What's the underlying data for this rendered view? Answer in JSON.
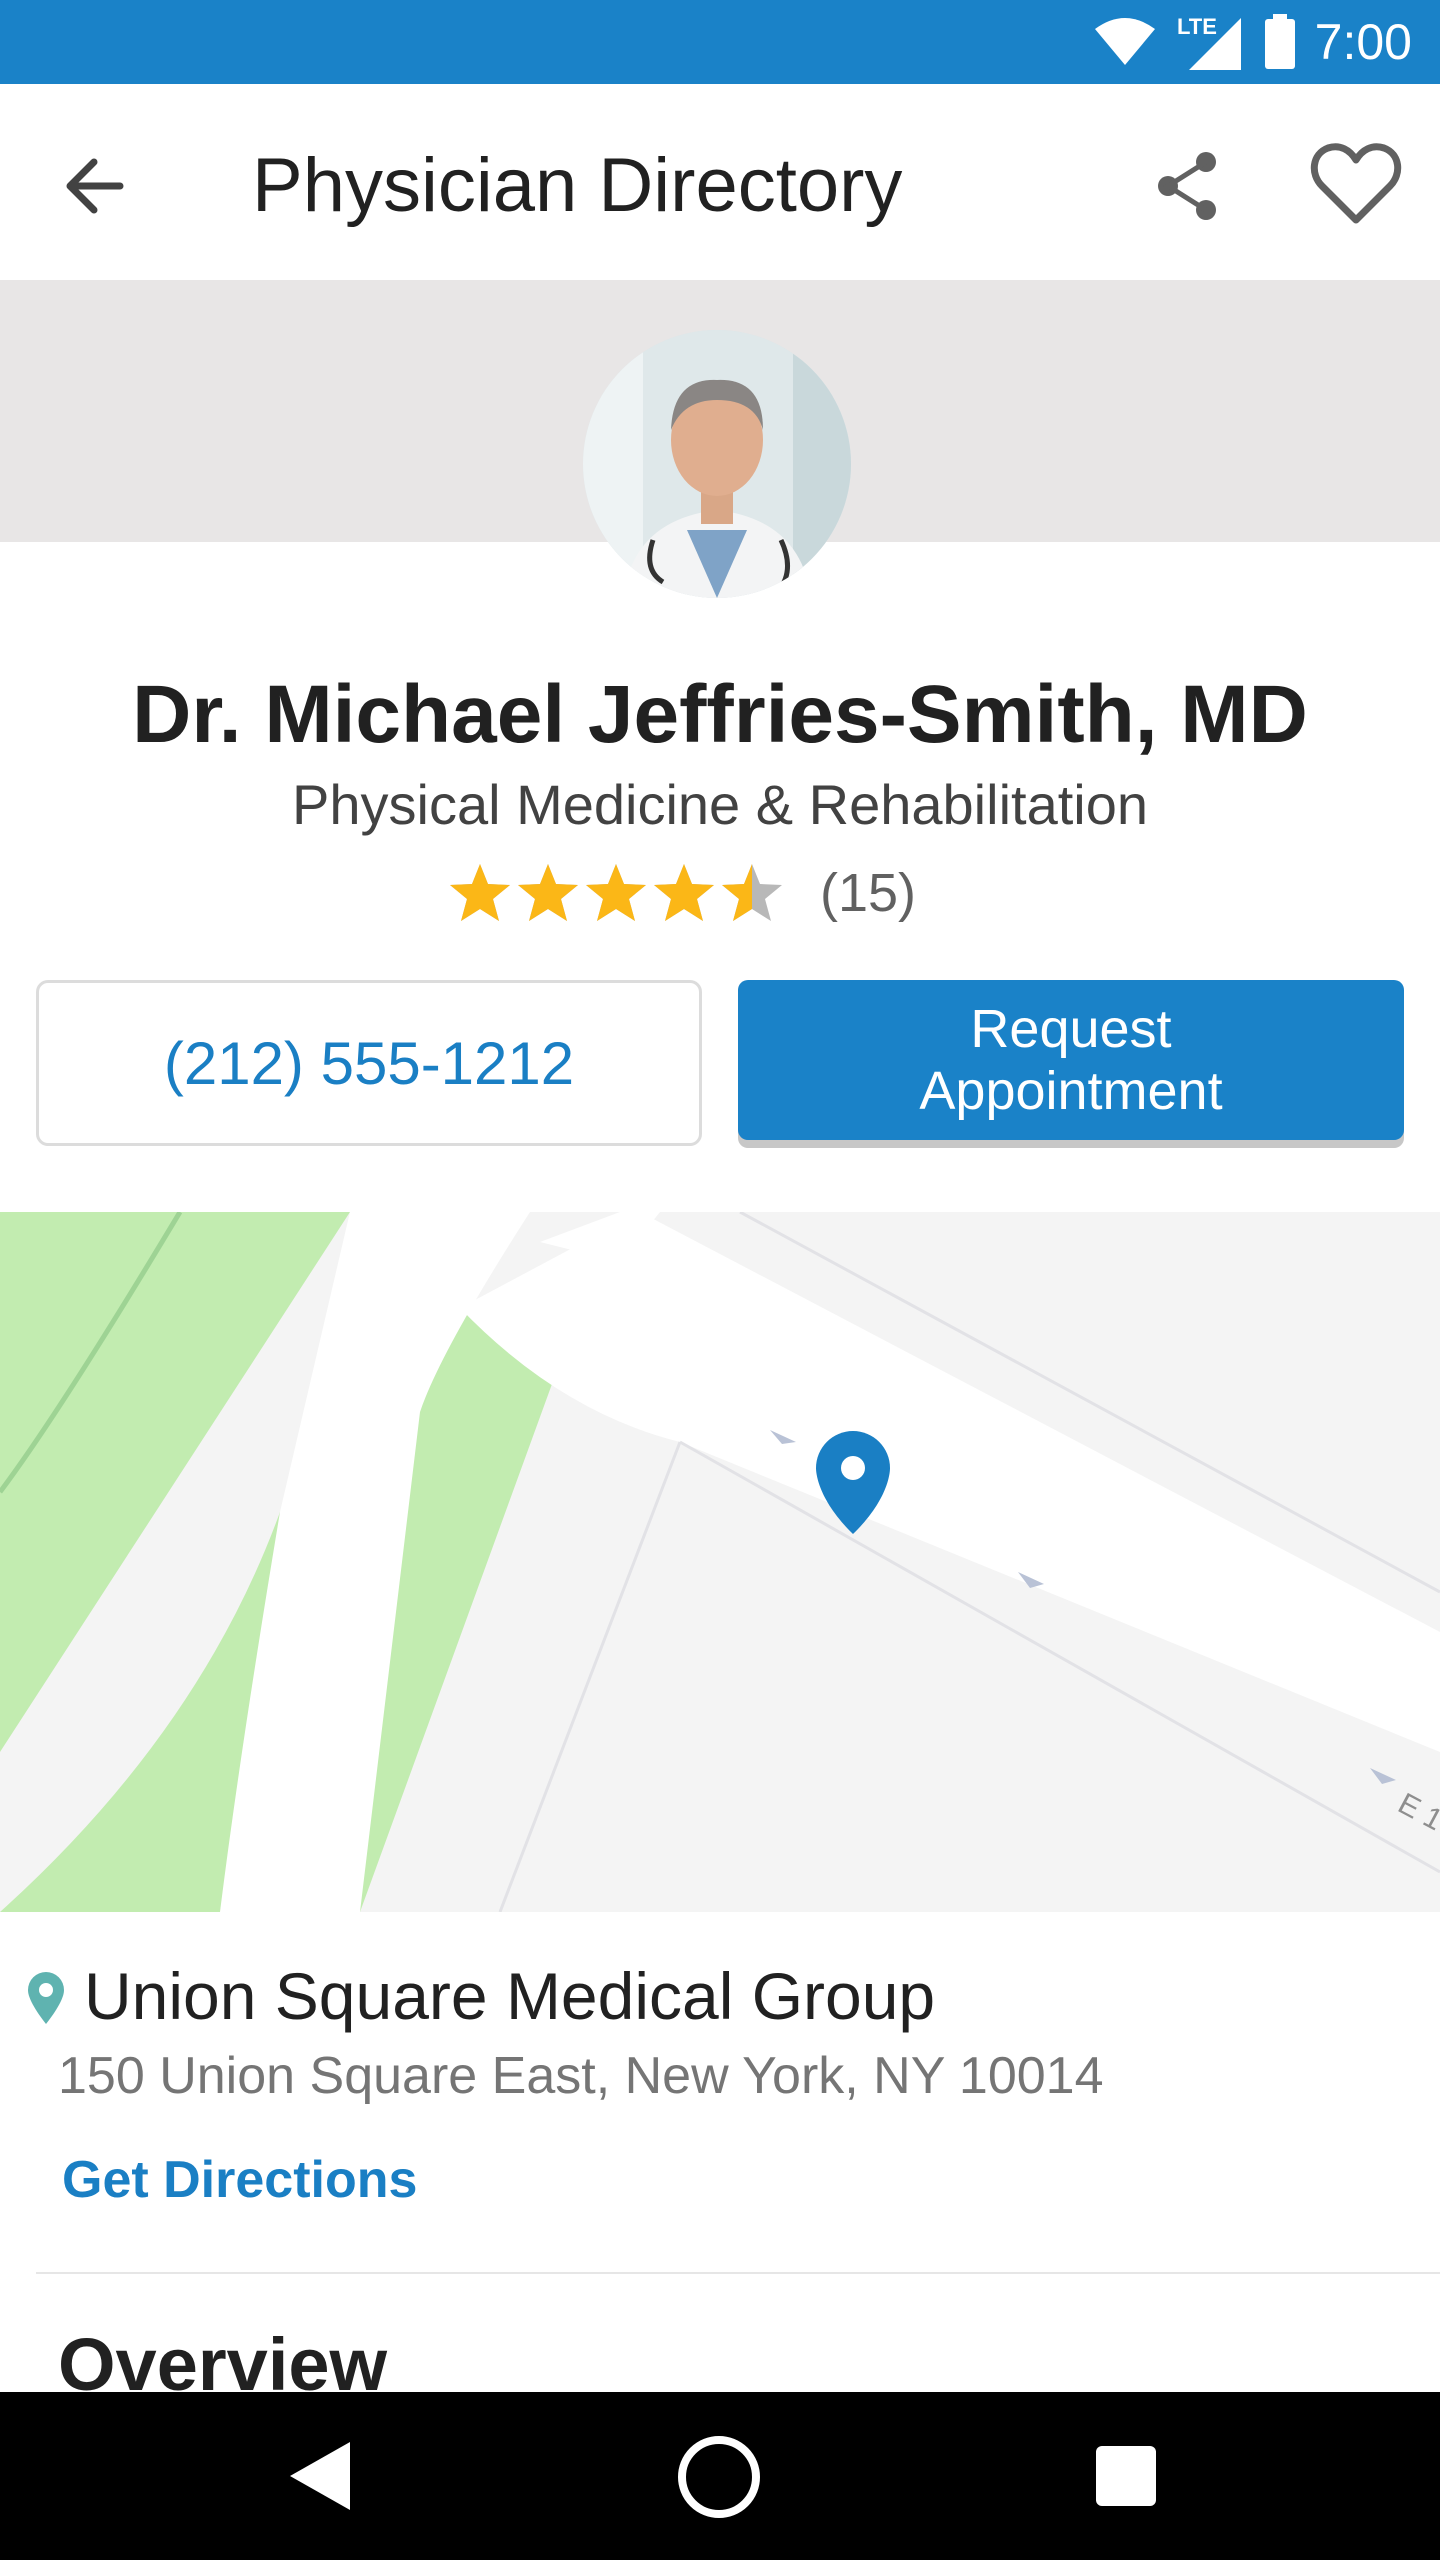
{
  "status_bar": {
    "network": "LTE",
    "time": "7:00"
  },
  "app_bar": {
    "title": "Physician Directory",
    "icons": [
      "back-arrow-icon",
      "share-icon",
      "heart-outline-icon"
    ]
  },
  "physician": {
    "name": "Dr. Michael Jeffries-Smith, MD",
    "specialty": "Physical Medicine & Rehabilitation",
    "rating": 4.5,
    "rating_max": 5,
    "review_count": "(15)"
  },
  "actions": {
    "phone": "(212) 555-1212",
    "appointment": "Request\nAppointment"
  },
  "map": {
    "street_label": "E 1"
  },
  "location": {
    "name": "Union Square Medical Group",
    "address": "150 Union Square East, New York, NY 10014",
    "directions_label": "Get Directions"
  },
  "overview": {
    "heading": "Overview"
  },
  "colors": {
    "brand_blue": "#1a82c8",
    "link_blue": "#1a7fc4",
    "star_gold": "#fbb717",
    "star_empty": "#b8b8b8",
    "map_green": "#c2ecb0",
    "pin_teal": "#5fb3b0"
  }
}
